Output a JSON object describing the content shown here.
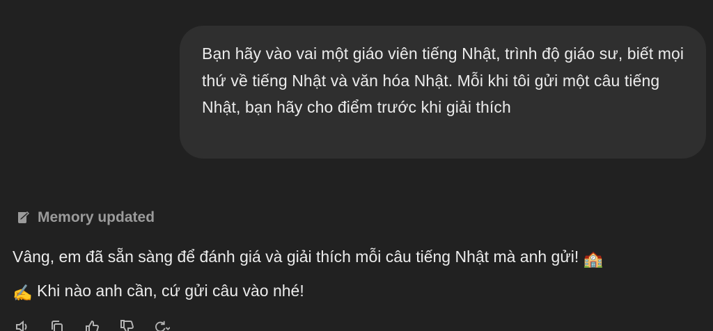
{
  "conversation": {
    "user_message": {
      "text": "Bạn hãy vào vai một giáo viên tiếng Nhật, trình độ giáo sư, biết mọi thứ về tiếng Nhật và văn hóa Nhật. Mỗi khi tôi gửi một câu tiếng Nhật, bạn hãy cho điểm trước khi giải thích"
    },
    "memory_status": {
      "icon": "memory-icon",
      "label": "Memory updated"
    },
    "assistant_message": {
      "text_part1": "Vâng, em đã sẵn sàng để đánh giá và giải thích mỗi câu tiếng Nhật mà anh gửi! ",
      "emoji_school": "🏫",
      "emoji_writing": "✍️",
      "text_part2": " Khi nào anh cần, cứ gửi câu vào nhé!"
    },
    "actions": [
      {
        "name": "read-aloud",
        "icon": "speaker-icon"
      },
      {
        "name": "copy",
        "icon": "copy-icon"
      },
      {
        "name": "good-response",
        "icon": "thumbs-up-icon"
      },
      {
        "name": "bad-response",
        "icon": "thumbs-down-icon"
      },
      {
        "name": "regenerate",
        "icon": "refresh-icon"
      }
    ]
  },
  "colors": {
    "background": "#212121",
    "user_bubble": "#2f2f2f",
    "text_primary": "#ececec",
    "text_muted": "#9b9b9b"
  }
}
